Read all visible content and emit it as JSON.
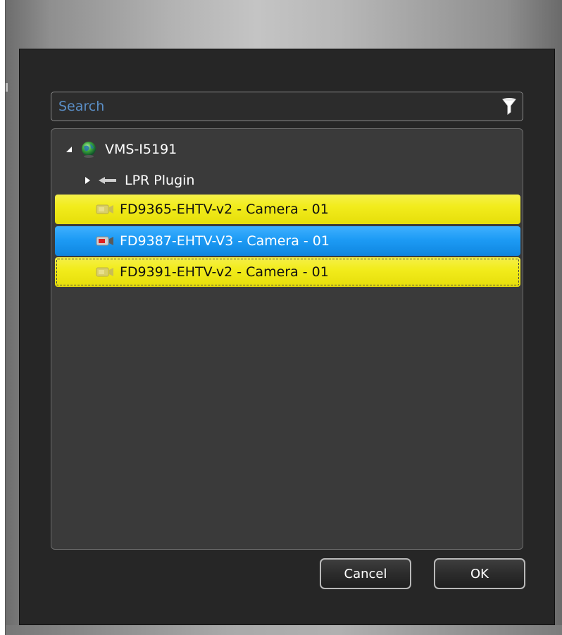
{
  "search": {
    "placeholder": "Search"
  },
  "icons": {
    "filter": "filter-funnel-icon",
    "server": "globe-server-icon",
    "plugin": "plugin-arrow-icon",
    "camera": "camera-icon",
    "camera_selected": "camera-red-icon"
  },
  "tree": {
    "root": {
      "label": "VMS-I5191",
      "expanded": true
    },
    "plugin": {
      "label": "LPR Plugin",
      "expanded": false
    },
    "cameras": [
      {
        "label": "FD9365-EHTV-v2 - Camera - 01",
        "state": "highlighted"
      },
      {
        "label": "FD9387-EHTV-V3 - Camera - 01",
        "state": "selected"
      },
      {
        "label": "FD9391-EHTV-v2 - Camera - 01",
        "state": "highlighted-focused"
      }
    ]
  },
  "buttons": {
    "cancel": "Cancel",
    "ok": "OK"
  },
  "colors": {
    "highlight_yellow": "#f2ec1c",
    "selection_blue": "#1d9bf5",
    "panel_bg": "#262626",
    "tree_bg": "#3a3a3a",
    "search_text": "#5a8ec6"
  }
}
